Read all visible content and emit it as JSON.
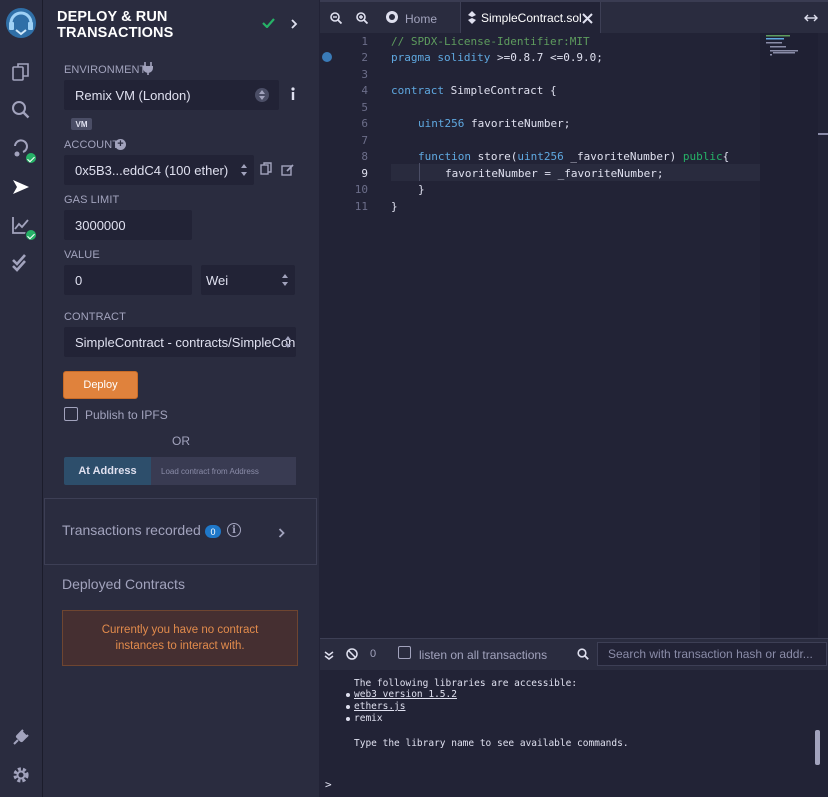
{
  "sidebar_rail": {
    "icons": [
      "remix-logo-icon",
      "file-explorer-icon",
      "search-icon",
      "solidity-compiler-icon",
      "deploy-run-icon",
      "analysis-icon",
      "testing-icon",
      "plugin-manager-icon",
      "settings-icon"
    ]
  },
  "panel": {
    "title_line1": "DEPLOY & RUN",
    "title_line2": "TRANSACTIONS",
    "environment_label": "ENVIRONMENT",
    "environment_value": "Remix VM (London)",
    "vm_badge": "VM",
    "account_label": "ACCOUNT",
    "account_value": "0x5B3...eddC4 (100 ether)",
    "gas_limit_label": "GAS LIMIT",
    "gas_limit_value": "3000000",
    "value_label": "VALUE",
    "value_amount": "0",
    "value_unit": "Wei",
    "contract_label": "CONTRACT",
    "contract_value": "SimpleContract - contracts/SimpleCon",
    "deploy_label": "Deploy",
    "publish_label": "Publish to IPFS",
    "or_label": "OR",
    "at_address_label": "At Address",
    "at_address_placeholder": "Load contract from Address",
    "transactions_label": "Transactions recorded",
    "transactions_count": "0",
    "deployed_label": "Deployed Contracts",
    "no_contracts_message": "Currently you have no contract instances to interact with."
  },
  "editor": {
    "tabs": [
      {
        "label": "Home"
      },
      {
        "label": "SimpleContract.sol"
      }
    ],
    "line_numbers": [
      "1",
      "2",
      "3",
      "4",
      "5",
      "6",
      "7",
      "8",
      "9",
      "10",
      "11"
    ],
    "current_line": "9",
    "code": {
      "l1": "// SPDX-License-Identifier:MIT",
      "l2_kw": "pragma solidity",
      "l2_rest": " >=0.8.7 <=0.9.0;",
      "l4_kw": "contract",
      "l4_rest": " SimpleContract {",
      "l6_kw": "uint256",
      "l6_rest": " favoriteNumber;",
      "l8_kw1": "function",
      "l8_mid1": " store(",
      "l8_kw2": "uint256",
      "l8_mid2": " _favoriteNumber) ",
      "l8_kw3": "public",
      "l8_end": "{",
      "l9": "favoriteNumber = _favoriteNumber;",
      "l10": "}",
      "l11": "}"
    }
  },
  "terminal": {
    "count": "0",
    "listen_label": "listen on all transactions",
    "search_placeholder": "Search with transaction hash or addr...",
    "line1": "The following libraries are accessible:",
    "lib1": "web3 version 1.5.2",
    "lib2": "ethers.js",
    "lib3": "remix",
    "line_hint": "Type the library name to see available commands.",
    "prompt": ">"
  }
}
